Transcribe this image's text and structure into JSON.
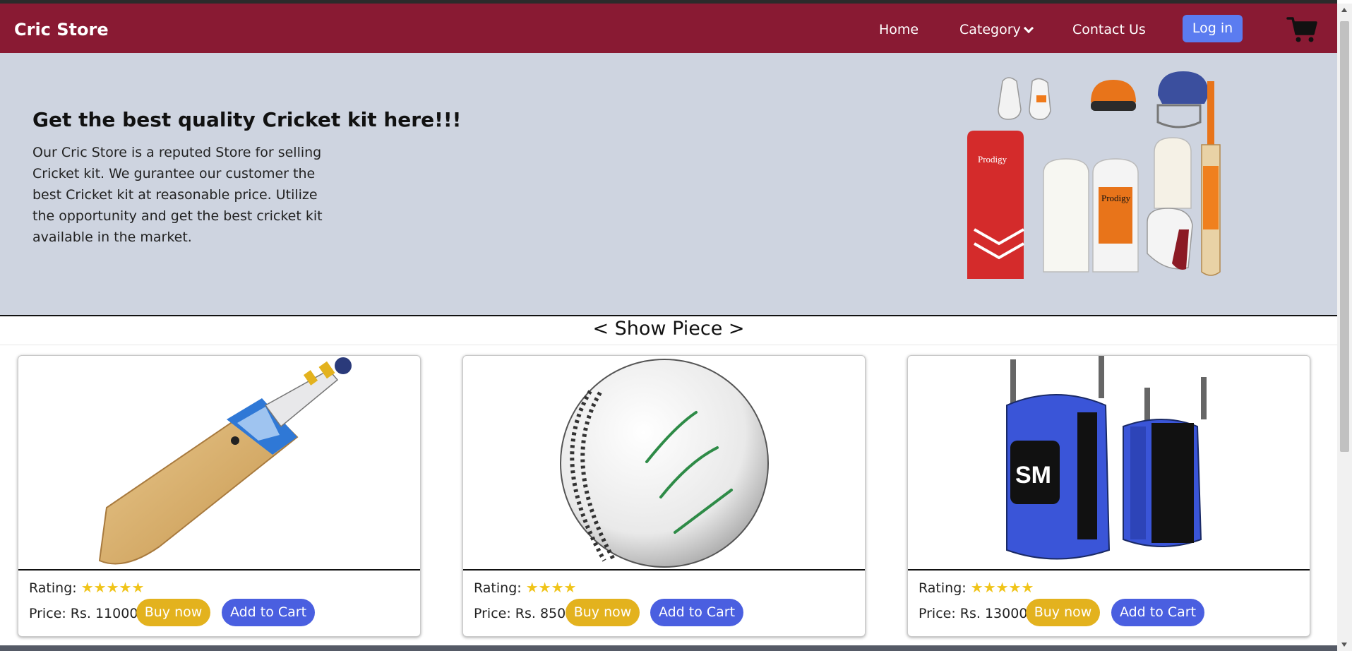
{
  "nav": {
    "brand": "Cric Store",
    "links": [
      "Home",
      "Category",
      "Contact Us"
    ],
    "login_label": "Log in",
    "cart_icon": "cart-icon",
    "background": "#891a33",
    "login_color": "#5b7cf0"
  },
  "hero": {
    "title": "Get the best quality Cricket kit here!!!",
    "text": "Our Cric Store is a reputed Store for selling Cricket kit. We gurantee our customer the best Cricket kit at reasonable price. Utilize the opportunity and get the best cricket kit available in the market.",
    "background": "#ced4e0"
  },
  "section": {
    "title": "< Show Piece >"
  },
  "products": [
    {
      "name": "cricket-bat",
      "rating_label": "Rating:",
      "stars": "★★★★★",
      "star_count": 5,
      "price": "Price: Rs. 11000",
      "buy_label": "Buy now",
      "cart_label": "Add to Cart"
    },
    {
      "name": "cricket-ball",
      "rating_label": "Rating:",
      "stars": "★★★★",
      "star_count": 4,
      "price": "Price: Rs. 850",
      "buy_label": "Buy now",
      "cart_label": "Add to Cart"
    },
    {
      "name": "kit-bag",
      "rating_label": "Rating:",
      "stars": "★★★★★",
      "star_count": 5,
      "price": "Price: Rs. 13000",
      "buy_label": "Buy now",
      "cart_label": "Add to Cart"
    }
  ],
  "colors": {
    "buy_button": "#e3b21e",
    "cart_button": "#4a5fe0",
    "star": "#f0c419"
  }
}
